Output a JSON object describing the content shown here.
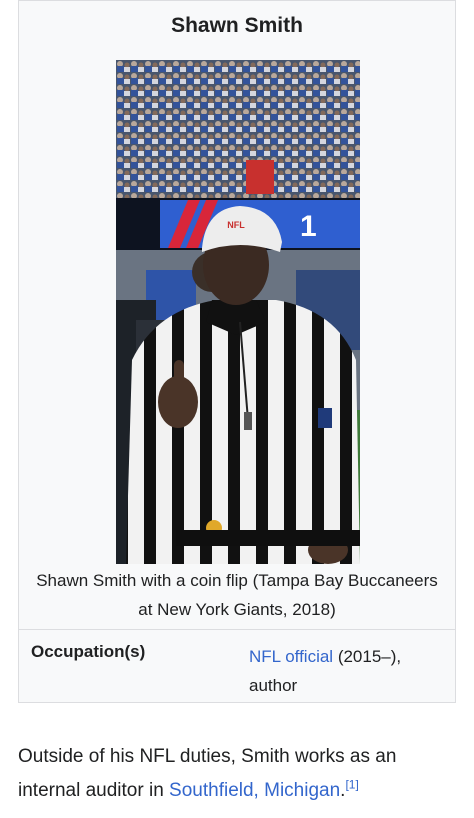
{
  "infobox": {
    "title": "Shawn Smith",
    "photo_label": "referee-photo",
    "caption": "Shawn Smith with a coin flip (Tampa Bay Buccaneers at New York Giants, 2018)",
    "scoreboard_digit": "1",
    "cap_text": "NFL",
    "occupation_label": "Occupation(s)",
    "occupation_link": "NFL official",
    "occupation_years": " (2015–),",
    "occupation_extra": "author"
  },
  "article": {
    "text_before": "Outside of his NFL duties, Smith works as an internal auditor in ",
    "location_link": "Southfield, Michigan",
    "text_after": ".",
    "ref": "[1]"
  },
  "colors": {
    "link": "#3366cc",
    "infobox_bg": "#f8f9fa",
    "border": "#dcdde0"
  }
}
